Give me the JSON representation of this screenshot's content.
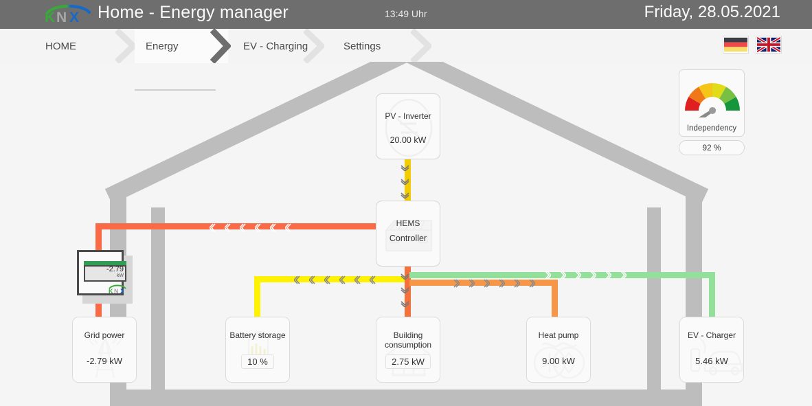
{
  "titlebar": {
    "logo": "knx-logo",
    "app_title": "Home - Energy manager",
    "clock": "13:49 Uhr",
    "date": "Friday, 28.05.2021"
  },
  "nav": {
    "tabs": [
      {
        "label": "HOME",
        "active": false
      },
      {
        "label": "Energy",
        "active": true
      },
      {
        "label": "EV - Charging",
        "active": false
      },
      {
        "label": "Settings",
        "active": false
      }
    ]
  },
  "flags": [
    {
      "name": "german-flag",
      "title": "Deutsch"
    },
    {
      "name": "uk-flag",
      "title": "English"
    }
  ],
  "gauge": {
    "label": "Independency",
    "value": "92 %",
    "percent": 92,
    "segment_colors": [
      "#e02020",
      "#f07818",
      "#f5c518",
      "#e0dc1a",
      "#77c043",
      "#16963c"
    ]
  },
  "devices": {
    "pv_inverter": {
      "title": "PV - Inverter",
      "value": "20.00 kW",
      "icon": "pv-inverter-icon"
    },
    "hems": {
      "title_1": "HEMS",
      "title_2": "Controller",
      "icon": "hems-controller-icon"
    },
    "grid_power": {
      "title": "Grid power",
      "value": "-2.79 kW",
      "icon": "pylon-icon"
    },
    "battery_storage": {
      "title": "Battery storage",
      "value": "10 %",
      "icon": "battery-icon"
    },
    "building_consumption": {
      "title_1": "Building",
      "title_2": "consumption",
      "value": "2.75 kW",
      "icon": "house-icon"
    },
    "heat_pump": {
      "title": "Heat pump",
      "value": "9.00 kW",
      "icon": "heatpump-icon"
    },
    "ev_charger": {
      "title": "EV - Charger",
      "value": "5.46 kW",
      "icon": "ev-charger-icon"
    }
  },
  "meter": {
    "value": "-2.79",
    "unit": "kW",
    "brand": "KNX"
  },
  "flows": {
    "colors": {
      "pv": "#f5cc00",
      "grid": "#fa6a46",
      "battery": "#fff200",
      "building": "#f5713c",
      "heatpump": "#f79646",
      "ev": "#92e09a"
    },
    "directions": {
      "pv_to_hems": "down",
      "hems_to_grid": "left",
      "hems_to_battery": "left",
      "hems_to_building": "down",
      "hems_to_heatpump": "right",
      "hems_to_ev": "right"
    }
  }
}
